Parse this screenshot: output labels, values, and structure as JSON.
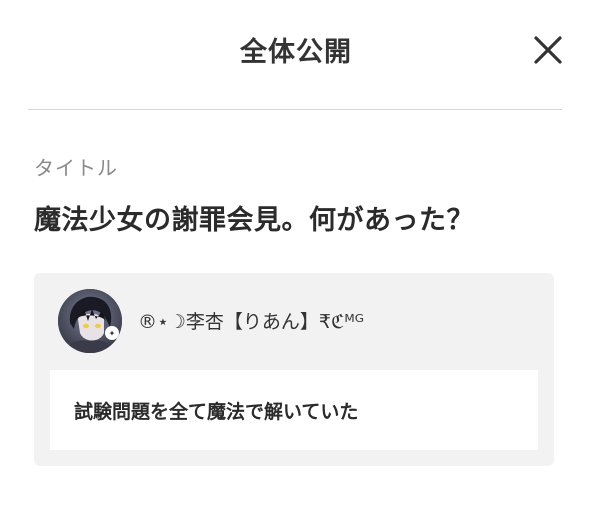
{
  "header": {
    "title": "全体公開",
    "close_icon": "close-icon"
  },
  "form": {
    "title_label": "タイトル",
    "title_value": "魔法少女の謝罪会見。何があった？"
  },
  "comment_card": {
    "user_name": "®⋆☽李杏【りあん】₹ℭᴹᴳ",
    "comment_text": "試験問題を全て魔法で解いていた",
    "avatar_icon": "user-avatar"
  },
  "colors": {
    "divider": "#d6d6d6",
    "card_background": "#f2f2f2",
    "label_gray": "#8a8a8a"
  }
}
